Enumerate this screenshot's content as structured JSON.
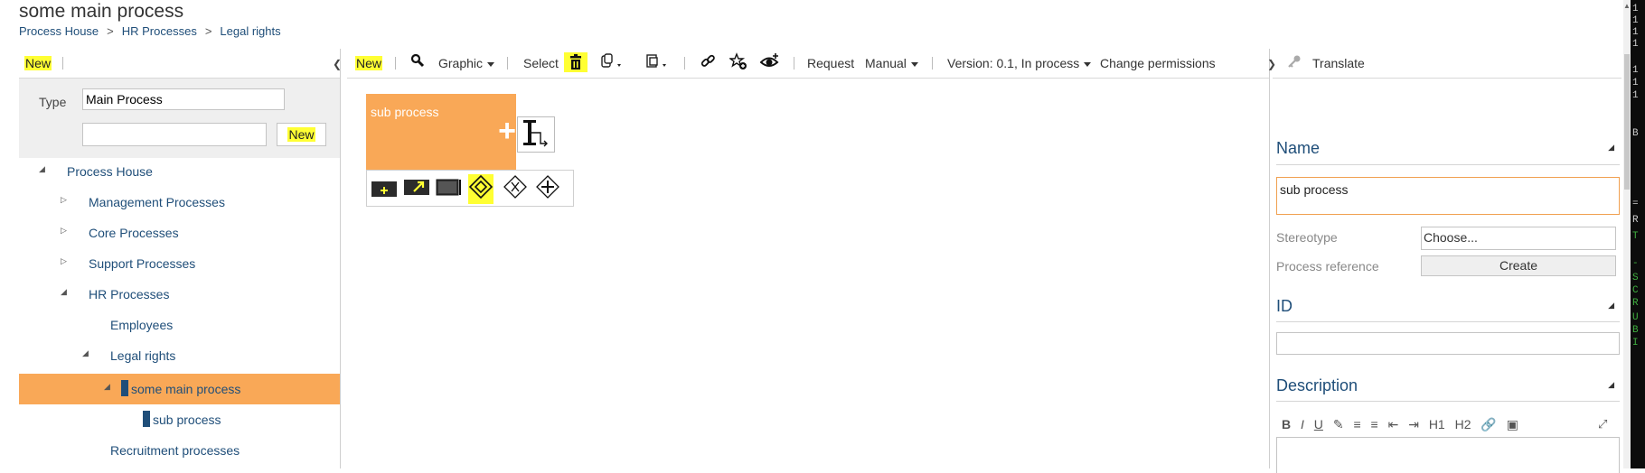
{
  "page": {
    "title": "some main process",
    "breadcrumb": [
      "Process House",
      "HR Processes",
      "Legal rights"
    ],
    "breadcrumb_separator": ">"
  },
  "left_panel": {
    "new_label": "New",
    "filter": {
      "type_label": "Type",
      "type_value": "Main Process",
      "name_value": "",
      "new_button_label": "New"
    },
    "tree": [
      {
        "label": "Process House",
        "depth": 0,
        "expanded": true
      },
      {
        "label": "Management Processes",
        "depth": 1,
        "expanded": false
      },
      {
        "label": "Core Processes",
        "depth": 1,
        "expanded": false
      },
      {
        "label": "Support Processes",
        "depth": 1,
        "expanded": false
      },
      {
        "label": "HR Processes",
        "depth": 1,
        "expanded": true
      },
      {
        "label": "Employees",
        "depth": 2
      },
      {
        "label": "Legal rights",
        "depth": 2,
        "expanded": true
      },
      {
        "label": "some main process",
        "depth": 3,
        "expanded": true,
        "selected": true
      },
      {
        "label": "sub process",
        "depth": 4
      },
      {
        "label": "Recruitment processes",
        "depth": 2
      }
    ]
  },
  "center_toolbar": {
    "new_label": "New",
    "graphic_label": "Graphic",
    "select_label": "Select",
    "request_label": "Request",
    "manual_label": "Manual",
    "version_label": "Version: 0.1, In process",
    "permissions_label": "Change permissions"
  },
  "canvas": {
    "shape_label": "sub process",
    "accent_color": "#f9a857"
  },
  "right_panel": {
    "translate_label": "Translate",
    "name_section": "Name",
    "name_value": "sub process",
    "stereotype_label": "Stereotype",
    "stereotype_value": "Choose...",
    "process_reference_label": "Process reference",
    "create_label": "Create",
    "id_section": "ID",
    "id_value": "",
    "description_section": "Description",
    "editor_buttons": [
      "B",
      "I",
      "U",
      "H1",
      "H2"
    ]
  },
  "terminal_strip": {
    "chars": [
      "1",
      "1",
      "1",
      "1",
      "1",
      "1",
      "1",
      "B",
      "=",
      "R",
      "T",
      "-",
      "S",
      "C",
      "R",
      "U",
      "B",
      "I"
    ]
  }
}
